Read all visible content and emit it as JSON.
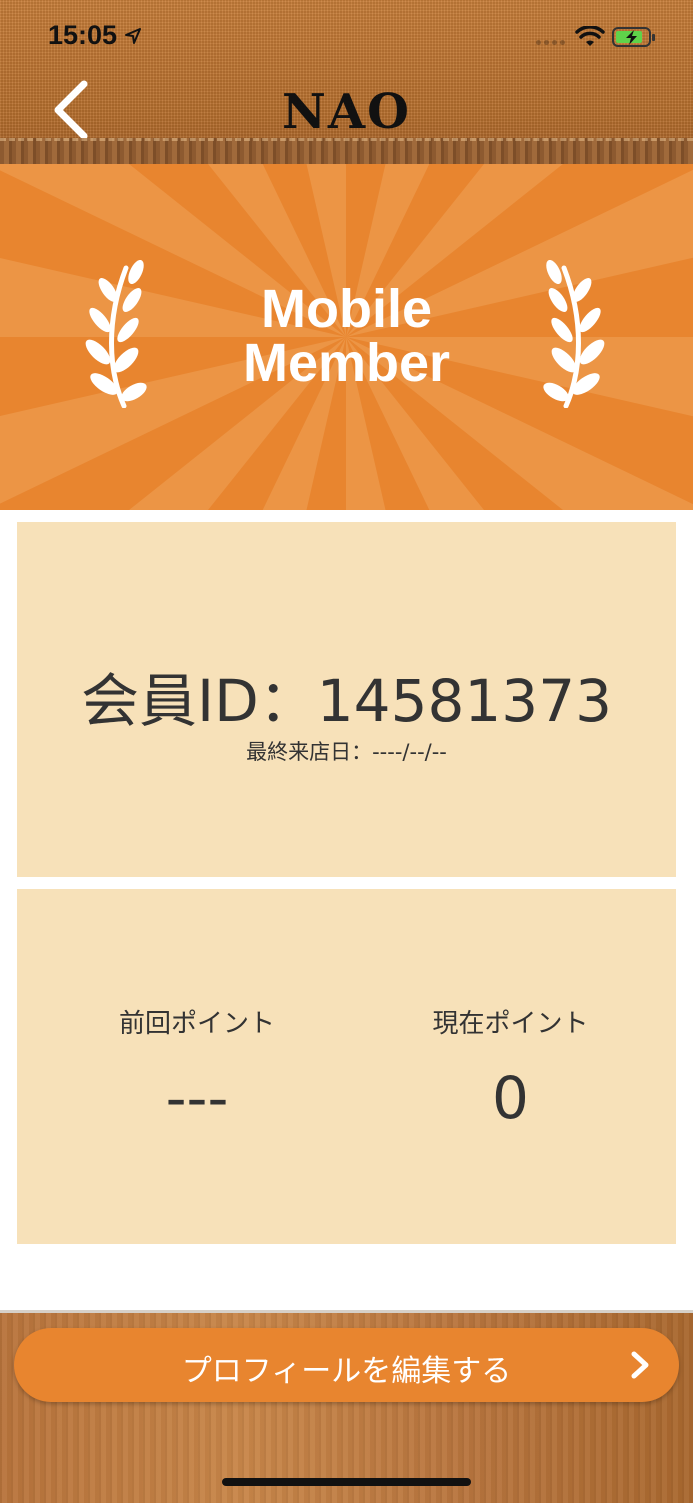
{
  "status_bar": {
    "time": "15:05",
    "icons": [
      "location-arrow-icon",
      "signal-icon",
      "wifi-icon",
      "battery-charging-icon"
    ]
  },
  "nav": {
    "title": "NAO",
    "back_icon": "chevron-left-icon"
  },
  "banner": {
    "line1": "Mobile",
    "line2": "Member",
    "decoration": "laurel-icon"
  },
  "member": {
    "id_label": "会員ID：",
    "id_value": "14581373",
    "last_visit_label": "最終来店日：",
    "last_visit_value": "----/--/--"
  },
  "points": {
    "previous_label": "前回ポイント",
    "previous_value": "---",
    "current_label": "現在ポイント",
    "current_value": "0"
  },
  "footer": {
    "edit_profile_label": "プロフィールを編集する",
    "chevron_icon": "chevron-right-icon"
  },
  "colors": {
    "accent": "#e8852f",
    "card": "#f7e1b9",
    "text": "#333333"
  }
}
